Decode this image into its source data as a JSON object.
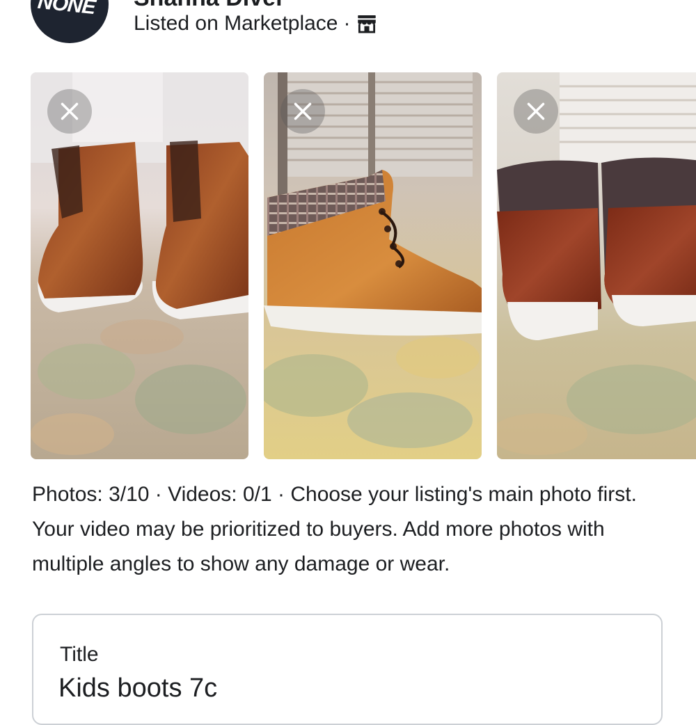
{
  "header": {
    "seller_name": "Shanna Diver",
    "avatar_text": "NONE",
    "listed_text": "Listed on Marketplace",
    "separator": "·",
    "store_icon": "store-icon"
  },
  "photos": {
    "items": [
      {
        "name": "brown leather kids boots, front view",
        "remove_icon": "close-icon"
      },
      {
        "name": "brown leather kids boot, side view",
        "remove_icon": "close-icon"
      },
      {
        "name": "brown leather kids boots, back view",
        "remove_icon": "close-icon"
      }
    ]
  },
  "help": {
    "text": "Photos: 3/10 · Videos: 0/1 · Choose your listing's main photo first. Your video may be prioritized to buyers. Add more photos with multiple angles to show any damage or wear."
  },
  "title_field": {
    "label": "Title",
    "value": "Kids boots 7c"
  },
  "colors": {
    "text": "#1c1e21",
    "field_border": "#ccd0d5",
    "avatar_bg": "#1e2430"
  }
}
